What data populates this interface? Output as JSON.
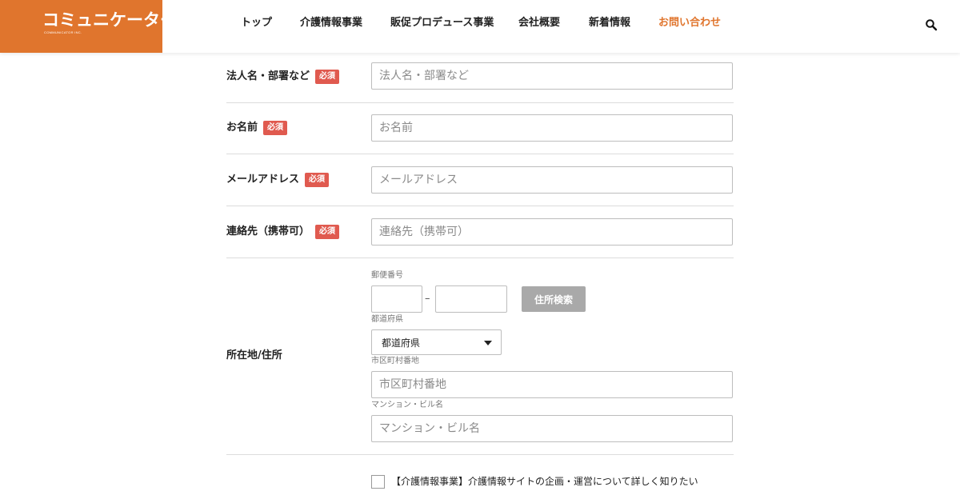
{
  "header": {
    "logo_text": "コミュニケーター",
    "logo_subtext": "COMMUNICATOR INC.",
    "brand_color": "#e0752d",
    "nav": [
      {
        "label": "トップ",
        "active": false
      },
      {
        "label": "介護情報事業",
        "active": false
      },
      {
        "label": "販促プロデュース事業",
        "active": false
      },
      {
        "label": "会社概要",
        "active": false
      },
      {
        "label": "新着情報",
        "active": false
      },
      {
        "label": "お問い合わせ",
        "active": true
      }
    ],
    "search_icon": "search-icon"
  },
  "form": {
    "required_badge": "必須",
    "required_color": "#e05a4f",
    "company": {
      "label": "法人名・部署など",
      "placeholder": "法人名・部署など",
      "value": ""
    },
    "name": {
      "label": "お名前",
      "placeholder": "お名前",
      "value": ""
    },
    "email": {
      "label": "メールアドレス",
      "placeholder": "メールアドレス",
      "value": ""
    },
    "phone": {
      "label": "連絡先（携帯可）",
      "placeholder": "連絡先（携帯可）",
      "value": ""
    },
    "address": {
      "label": "所在地/住所",
      "zip_label": "郵便番号",
      "zip_dash": "–",
      "zip_button": "住所検索",
      "prefecture_label": "都道府県",
      "prefecture_value": "都道府県",
      "city_label": "市区町村番地",
      "city_placeholder": "市区町村番地",
      "building_label": "マンション・ビル名",
      "building_placeholder": "マンション・ビル名"
    },
    "interest_checkbox": {
      "label": "【介護情報事業】介護情報サイトの企画・運営について詳しく知りたい",
      "checked": false
    }
  }
}
